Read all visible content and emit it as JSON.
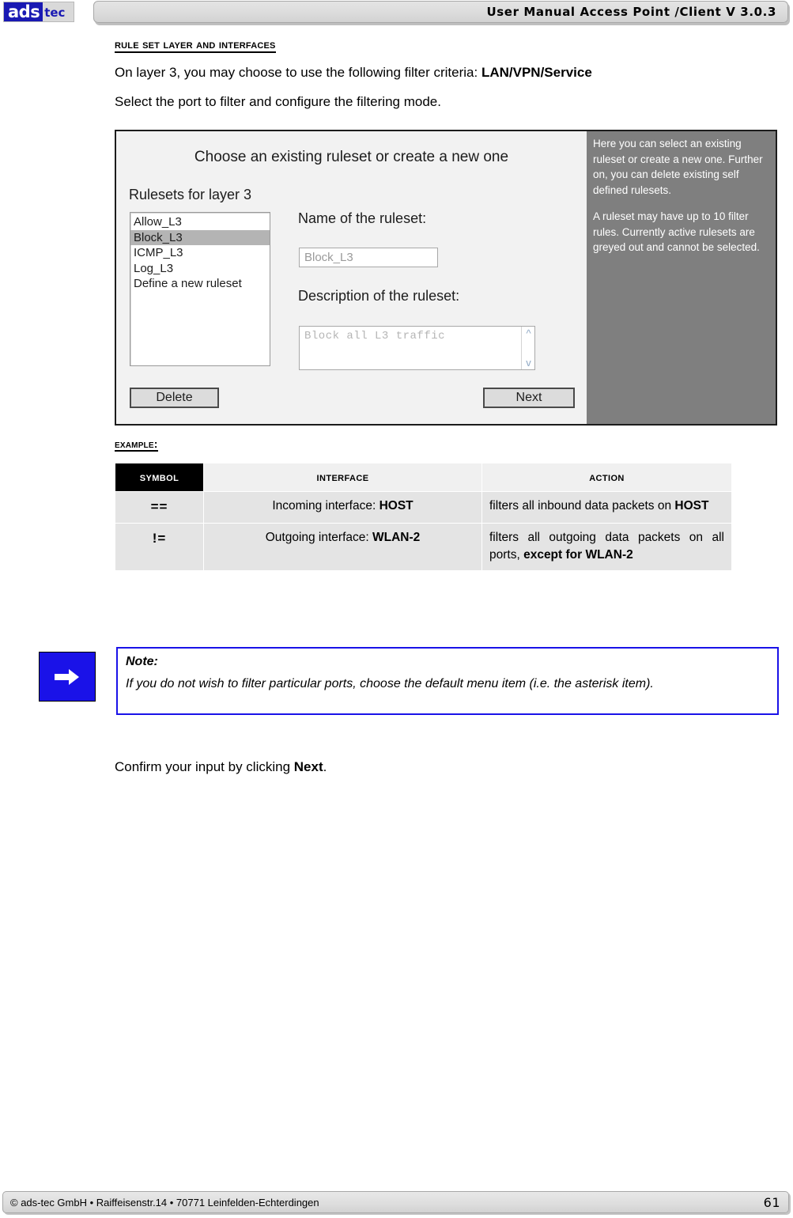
{
  "header": {
    "logo_primary": "ads",
    "logo_secondary": "tec",
    "title": "User Manual Access  Point /Client V 3.0.3"
  },
  "main": {
    "section_title": "Rule set Layer and Interfaces",
    "paragraph_1_pre": "On layer 3, you may choose to use the following filter criteria: ",
    "paragraph_1_bold": "LAN/VPN/Service",
    "paragraph_2": "Select the port to filter and configure the filtering mode.",
    "example_label": "Example:",
    "confirm_pre": "Confirm your input by clicking ",
    "confirm_bold": "Next",
    "confirm_post": "."
  },
  "figure": {
    "heading": "Choose an existing ruleset or create a new one",
    "rulesets_label": "Rulesets for layer 3",
    "listbox_items": [
      {
        "label": "Allow_L3",
        "selected": false
      },
      {
        "label": "Block_L3",
        "selected": true
      },
      {
        "label": "ICMP_L3",
        "selected": false
      },
      {
        "label": "Log_L3",
        "selected": false
      },
      {
        "label": "Define a new ruleset",
        "selected": false
      }
    ],
    "name_label": "Name of the ruleset:",
    "name_value": "Block_L3",
    "description_label": "Description of the ruleset:",
    "description_value": "Block all L3 traffic",
    "scroll_up_icon": "^",
    "scroll_down_icon": "v",
    "delete_button": "Delete",
    "next_button": "Next",
    "help_paragraph_1": "Here you can select an existing ruleset or create a new one. Further on, you can delete existing self defined rulesets.",
    "help_paragraph_2": "A ruleset may have up to 10 filter rules. Currently active rulesets are greyed out and cannot be selected.",
    "help_panel_color": "#7f7f7f"
  },
  "table": {
    "headers": [
      "Symbol",
      "Interface",
      "Action"
    ],
    "rows": [
      {
        "symbol": "==",
        "interface_pre": "Incoming interface: ",
        "interface_bold": "HOST",
        "action_pre": "filters all inbound data packets on ",
        "action_bold": "HOST",
        "action_post": ""
      },
      {
        "symbol": "!=",
        "interface_pre": "Outgoing interface: ",
        "interface_bold": "WLAN-2",
        "action_pre": "filters all outgoing data packets on all ports, ",
        "action_bold": "except for WLAN-2",
        "action_post": ""
      }
    ]
  },
  "note": {
    "icon": "arrow-right-icon",
    "icon_color": "#1a12e8",
    "title": "Note:",
    "text": "If you do not wish to filter particular ports, choose the default menu item (i.e. the asterisk item)."
  },
  "footer": {
    "copyright": "© ads-tec GmbH • Raiffeisenstr.14 • 70771 Leinfelden-Echterdingen",
    "page_number": "61"
  }
}
